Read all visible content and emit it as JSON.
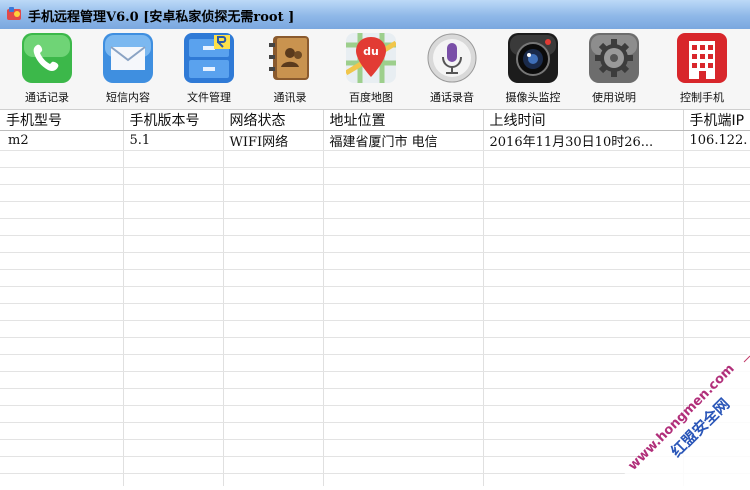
{
  "window": {
    "title": "手机远程管理V6.0 [安卓私家侦探无需root ]"
  },
  "toolbar": {
    "items": [
      {
        "label": "通话记录",
        "icon": "phone-icon"
      },
      {
        "label": "短信内容",
        "icon": "mail-icon"
      },
      {
        "label": "文件管理",
        "icon": "file-cabinet-icon"
      },
      {
        "label": "通讯录",
        "icon": "address-book-icon"
      },
      {
        "label": "百度地图",
        "icon": "baidu-map-icon"
      },
      {
        "label": "通话录音",
        "icon": "microphone-icon"
      },
      {
        "label": "摄像头监控",
        "icon": "camera-icon"
      },
      {
        "label": "使用说明",
        "icon": "settings-gear-icon"
      },
      {
        "label": "控制手机",
        "icon": "building-icon"
      }
    ]
  },
  "table": {
    "columns": [
      "手机型号",
      "手机版本号",
      "网络状态",
      "地址位置",
      "上线时间",
      "手机端IP"
    ],
    "rows": [
      [
        "m2",
        "5.1",
        "WIFI网络",
        "福建省厦门市 电信",
        "2016年11月30日10时26...",
        "106.122."
      ]
    ]
  },
  "watermark": {
    "text": "红盟安全网",
    "url_text": "www.hongmen.com"
  }
}
